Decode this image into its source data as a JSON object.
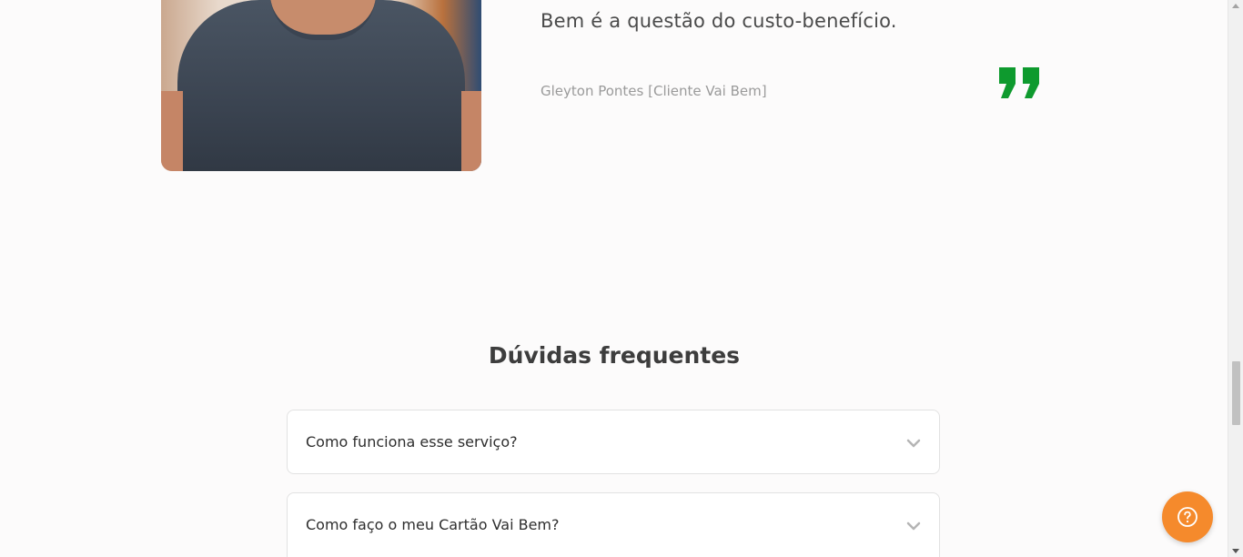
{
  "testimonial": {
    "quote_line": "Bem é a questão do custo-benefício.",
    "author": "Gleyton Pontes [Cliente Vai Bem]",
    "accent_color": "#0e9a2e",
    "quote_icon": "quote-icon"
  },
  "faq": {
    "title": "Dúvidas frequentes",
    "items": [
      {
        "question": "Como funciona esse serviço?"
      },
      {
        "question": "Como faço o meu Cartão Vai Bem?"
      }
    ],
    "chevron_icon": "chevron-down-icon"
  },
  "help": {
    "icon": "help-icon",
    "color": "#f58a2c"
  }
}
